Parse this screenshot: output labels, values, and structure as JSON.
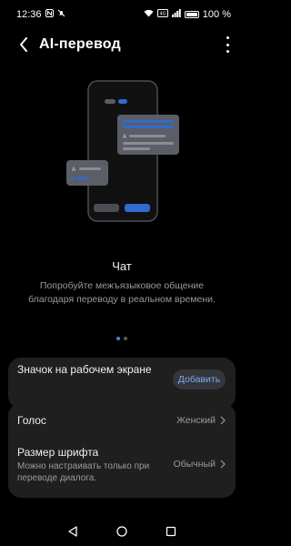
{
  "status_bar": {
    "time": "12:36",
    "battery": "100 %",
    "network": "VoLTE"
  },
  "app_bar": {
    "title": "AI-перевод"
  },
  "feature": {
    "title": "Чат",
    "description": "Попробуйте межъязыковое общение благодаря переводу в реальном времени."
  },
  "pager": {
    "count": 2,
    "active_index": 0
  },
  "home_shortcut": {
    "label": "Значок на рабочем экране",
    "button_label": "Добавить"
  },
  "settings": {
    "voice": {
      "label": "Голос",
      "value": "Женский"
    },
    "font_size": {
      "label": "Размер шрифта",
      "sublabel": "Можно настраивать только при переводе диалога.",
      "value": "Обычный"
    }
  },
  "colors": {
    "accent": "#4a7fd8",
    "button_text": "#7ea8f0",
    "card": "#1f1f1f",
    "background": "#000000"
  }
}
